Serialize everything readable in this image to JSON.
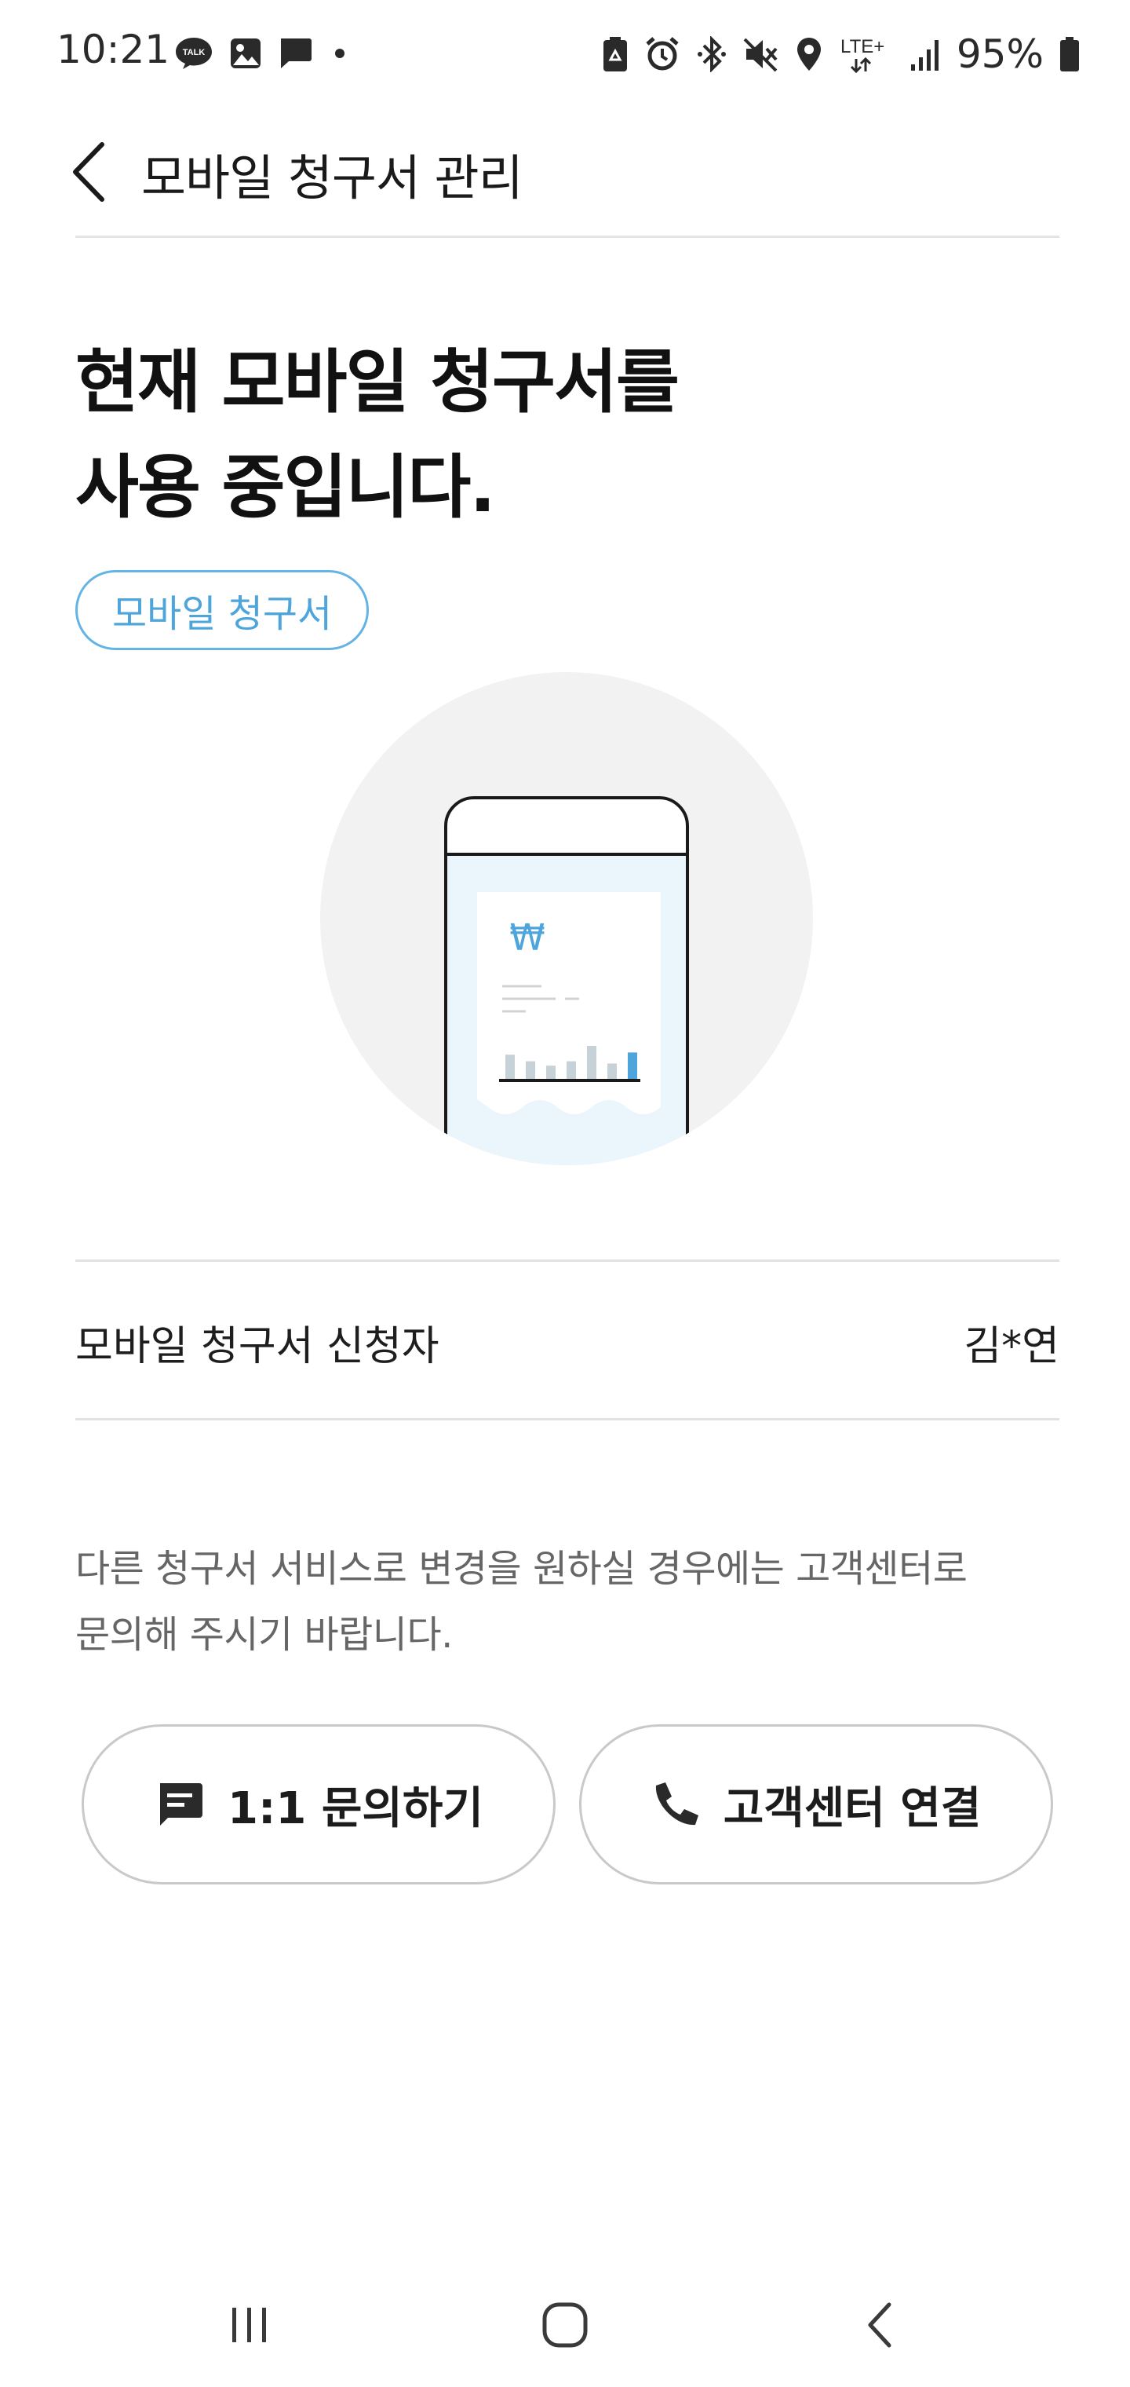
{
  "status_bar": {
    "time": "10:21",
    "battery_percent": "95%",
    "left_icons": [
      "kakaotalk-icon",
      "gallery-icon",
      "message-icon",
      "dot-icon"
    ],
    "right_icons": [
      "recycle-icon",
      "alarm-icon",
      "bluetooth-icon",
      "mute-icon",
      "location-icon",
      "lte-plus-icon",
      "signal-icon",
      "battery-icon"
    ],
    "kakao_badge": "TALK",
    "lte_label": "LTE+"
  },
  "app_bar": {
    "title": "모바일 청구서 관리",
    "back_icon": "chevron-left-icon"
  },
  "main": {
    "headline_line1": "현재 모바일 청구서를",
    "headline_line2": "사용 중입니다.",
    "chip_label": "모바일 청구서",
    "illustration": {
      "currency_symbol": "₩",
      "bar_levels": [
        0.55,
        0.4,
        0.3,
        0.4,
        0.75,
        0.35,
        0.6
      ],
      "highlight_bar_index": 6
    },
    "applicant_label": "모바일 청구서 신청자",
    "applicant_value": "김*연",
    "notice_line1": "다른 청구서 서비스로 변경을 원하실 경우에는 고객센터로",
    "notice_line2": "문의해 주시기 바랍니다.",
    "buttons": {
      "inquiry_label": "1:1 문의하기",
      "inquiry_icon": "chat-icon",
      "call_label": "고객센터 연결",
      "call_icon": "phone-icon"
    }
  },
  "nav_bar": {
    "items": [
      "recents-icon",
      "home-icon",
      "back-icon"
    ]
  },
  "colors": {
    "accent_blue": "#4ea5dc",
    "circle_bg": "#f2f2f2",
    "screen_bg": "#eaf5fc",
    "bar_gray": "#c7d2d8"
  }
}
